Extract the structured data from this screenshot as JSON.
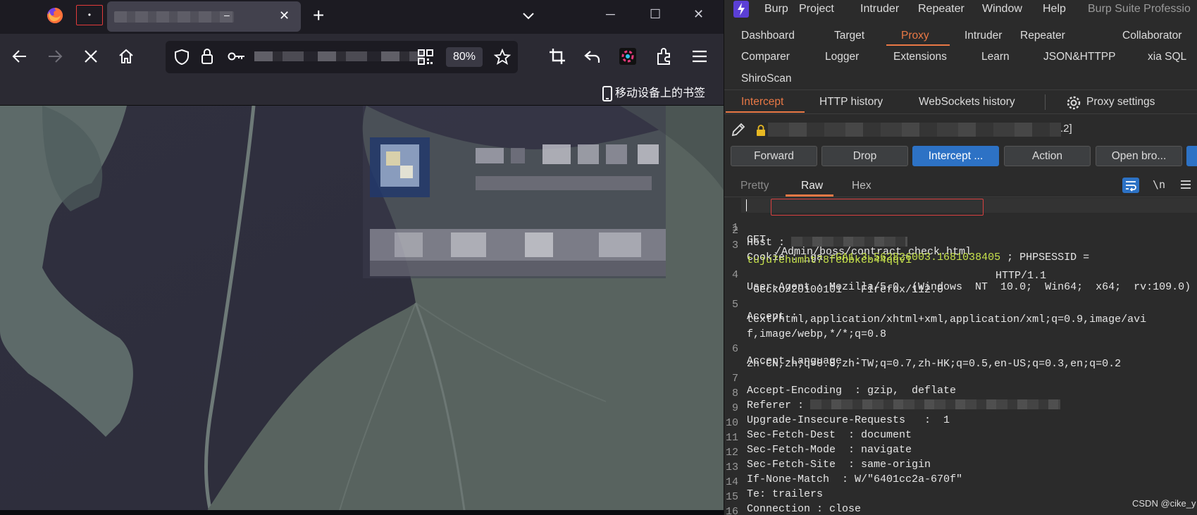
{
  "firefox": {
    "tab": {
      "close_glyph": "✕",
      "dash": "–"
    },
    "pinned_tab_glyph": "•",
    "new_tab_glyph": "+",
    "window_controls": {
      "minimize": "─",
      "maximize": "☐",
      "close": "✕"
    },
    "nav": {
      "zoom": "80%"
    },
    "bookmarks": {
      "mobile_label": "移动设备上的书签"
    }
  },
  "burp": {
    "menubar": [
      "Burp",
      "Project",
      "Intruder",
      "Repeater",
      "Window",
      "Help",
      "Burp Suite Professio"
    ],
    "main_tabs": [
      "Dashboard",
      "Target",
      "Proxy",
      "Intruder",
      "Repeater",
      "Collaborator",
      "Comparer",
      "Logger",
      "Extensions",
      "Learn",
      "JSON&HTTPP",
      "xia SQL",
      "ShiroScan"
    ],
    "active_main_tab": "Proxy",
    "proxy_tabs": [
      "Intercept",
      "HTTP history",
      "WebSockets history"
    ],
    "proxy_settings": "Proxy settings",
    "host_tail": ".2]",
    "buttons": {
      "forward": "Forward",
      "drop": "Drop",
      "intercept": "Intercept ...",
      "action": "Action",
      "open_browser": "Open bro..."
    },
    "editor_tabs": [
      "Pretty",
      "Raw",
      "Hex"
    ],
    "newline_toggle": "\\n",
    "request": {
      "line1": {
        "method": "GET",
        "path": "/Admin/boss/contract_check.html",
        "version": "HTTP/1.1"
      },
      "line2": {
        "key": "Host :"
      },
      "line3": {
        "key": "Cookie : _ga =",
        "value": "GA1.3.562826003.1681038405",
        "rest": " ; PHPSESSID ="
      },
      "line3b": "tuju7ehumht78fcbbkcb44qqv1",
      "line4": "User-Agent : Mozilla/5.0  (Windows  NT  10.0;  Win64;  x64;  rv:109.0)",
      "line4b": " Gecko/20100101   Firefox/112.0",
      "line5": "Accept :",
      "line5b": "text/html,application/xhtml+xml,application/xml;q=0.9,image/avi",
      "line5c": "f,image/webp,*/*;q=0.8",
      "line6": "Accept-Language  :",
      "line6b": "zh-CN,zh;q=0.8,zh-TW;q=0.7,zh-HK;q=0.5,en-US;q=0.3,en;q=0.2",
      "line7": "Accept-Encoding  : gzip,  deflate",
      "line8": {
        "key": "Referer : "
      },
      "line9": "Upgrade-Insecure-Requests   :  1",
      "line10": "Sec-Fetch-Dest  : document",
      "line11": "Sec-Fetch-Mode  : navigate",
      "line12": "Sec-Fetch-Site  : same-origin",
      "line13": "If-None-Match  : W/\"6401cc2a-670f\"",
      "line14": "Te: trailers",
      "line15": "Connection : close"
    },
    "line_numbers": [
      "1",
      "2",
      "3",
      "4",
      "5",
      "6",
      "7",
      "8",
      "9",
      "10",
      "11",
      "12",
      "13",
      "14",
      "15",
      "16"
    ]
  },
  "watermark": "CSDN @cike_y",
  "colors": {
    "accent_orange": "#e97845",
    "primary_blue": "#2d72c5",
    "cookie_green": "#c6e14b",
    "highlight_red": "#d84040"
  }
}
